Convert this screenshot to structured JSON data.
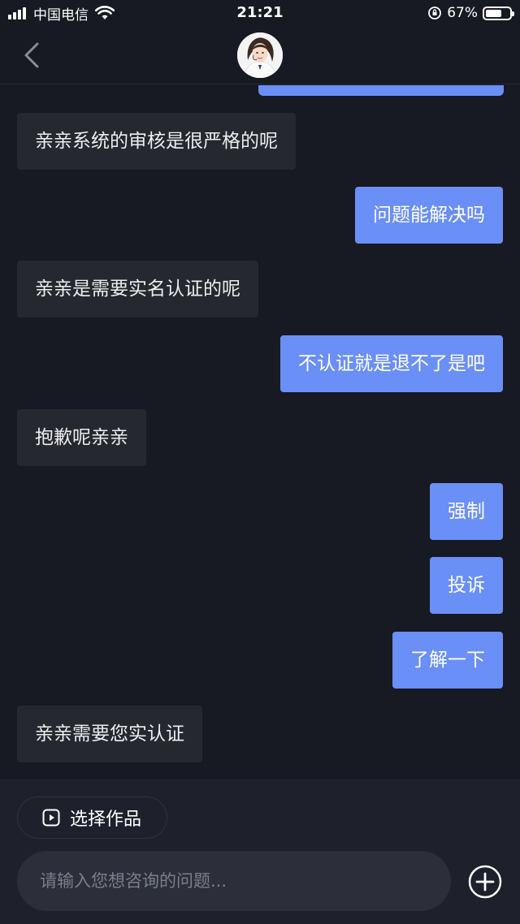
{
  "status_bar": {
    "carrier": "中国电信",
    "time": "21:21",
    "battery": "67%",
    "battery_level": 0.67
  },
  "header": {
    "back_icon": "chevron-left-icon",
    "avatar": "agent-avatar"
  },
  "messages": [
    {
      "side": "left",
      "text": "亲亲系统的审核是很严格的呢"
    },
    {
      "side": "right",
      "text": "问题能解决吗"
    },
    {
      "side": "left",
      "text": "亲亲是需要实名认证的呢"
    },
    {
      "side": "right",
      "text": "不认证就是退不了是吧"
    },
    {
      "side": "left",
      "text": "抱歉呢亲亲"
    },
    {
      "side": "right",
      "text": "强制"
    },
    {
      "side": "right",
      "text": "投诉"
    },
    {
      "side": "right",
      "text": "了解一下"
    },
    {
      "side": "left",
      "text": "亲亲需要您实认证"
    }
  ],
  "bottom": {
    "select_work_label": "选择作品",
    "input_placeholder": "请输入您想咨询的问题...",
    "input_value": ""
  },
  "colors": {
    "background": "#171923",
    "bubble_left": "#25282f",
    "bubble_right": "#6a8ff6"
  }
}
